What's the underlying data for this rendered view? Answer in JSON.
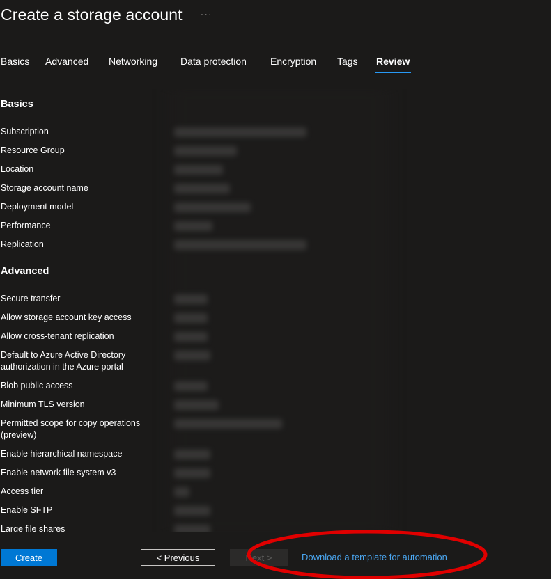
{
  "header": {
    "title": "Create a storage account",
    "more_label": "···"
  },
  "tabs": [
    {
      "label": "Basics",
      "active": false
    },
    {
      "label": "Advanced",
      "active": false
    },
    {
      "label": "Networking",
      "active": false
    },
    {
      "label": "Data protection",
      "active": false
    },
    {
      "label": "Encryption",
      "active": false
    },
    {
      "label": "Tags",
      "active": false
    },
    {
      "label": "Review",
      "active": true
    }
  ],
  "sections": [
    {
      "title": "Basics",
      "rows": [
        {
          "label": "Subscription"
        },
        {
          "label": "Resource Group"
        },
        {
          "label": "Location"
        },
        {
          "label": "Storage account name"
        },
        {
          "label": "Deployment model"
        },
        {
          "label": "Performance"
        },
        {
          "label": "Replication"
        }
      ]
    },
    {
      "title": "Advanced",
      "rows": [
        {
          "label": "Secure transfer"
        },
        {
          "label": "Allow storage account key access"
        },
        {
          "label": "Allow cross-tenant replication"
        },
        {
          "label": "Default to Azure Active Directory authorization in the Azure portal"
        },
        {
          "label": "Blob public access"
        },
        {
          "label": "Minimum TLS version"
        },
        {
          "label": "Permitted scope for copy operations (preview)"
        },
        {
          "label": "Enable hierarchical namespace"
        },
        {
          "label": "Enable network file system v3"
        },
        {
          "label": "Access tier"
        },
        {
          "label": "Enable SFTP"
        },
        {
          "label": "Large file shares"
        }
      ]
    }
  ],
  "footer": {
    "create_label": "Create",
    "previous_label": "< Previous",
    "next_label": "Next >",
    "download_label": "Download a template for automation"
  },
  "colors": {
    "background": "#1b1a19",
    "accent": "#0078d4",
    "link": "#4aa6f0",
    "tab_underline": "#2899f5",
    "annotation": "#e00000"
  }
}
